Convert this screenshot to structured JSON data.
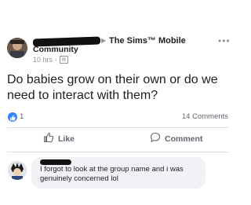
{
  "post": {
    "group_name": "The Sims™ Mobile",
    "author_suffix": "Community",
    "time": "10 hrs",
    "separator": "·",
    "text": "Do babies grow on their own or do we need to interact with them?",
    "like_count": "1",
    "comment_count": "14 Comments",
    "more": "•••"
  },
  "actions": {
    "like_label": "Like",
    "comment_label": "Comment"
  },
  "comment": {
    "text": "I forgot to look at the group name and i was genuinely concerned lol"
  },
  "colors": {
    "accent": "#2d88ff",
    "text": "#1c1e21",
    "muted": "#606770",
    "bubble": "#f0f2f5"
  }
}
